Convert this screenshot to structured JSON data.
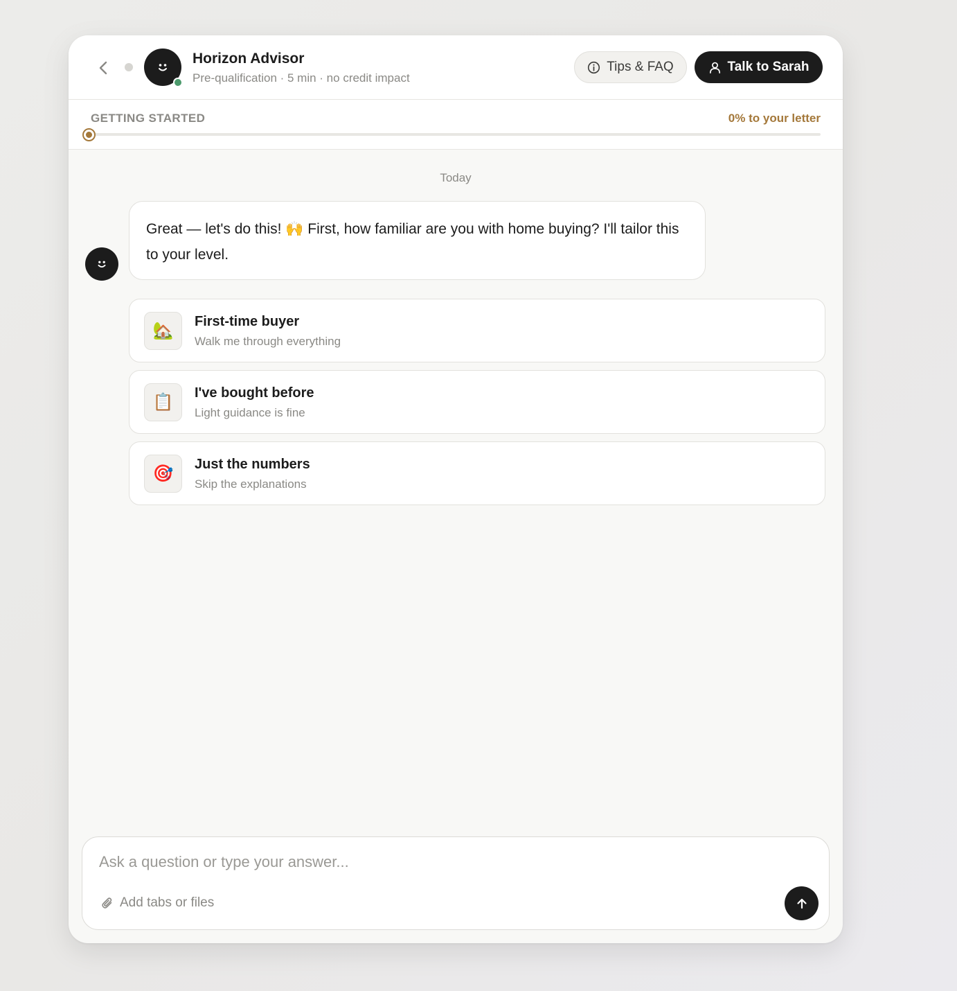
{
  "header": {
    "title": "Horizon Advisor",
    "subtitle": "Pre-qualification · 5 min · no credit impact",
    "tips_label": "Tips & FAQ",
    "talk_label": "Talk to Sarah"
  },
  "progress": {
    "stage": "GETTING STARTED",
    "percent_label": "0% to your letter",
    "percent": 0
  },
  "chat": {
    "date_label": "Today",
    "message": "Great — let's do this! 🙌 First, how familiar are you with home buying? I'll tailor this to your level.",
    "options": [
      {
        "icon": "🏡",
        "title": "First-time buyer",
        "subtitle": "Walk me through everything"
      },
      {
        "icon": "📋",
        "title": "I've bought before",
        "subtitle": "Light guidance is fine"
      },
      {
        "icon": "🎯",
        "title": "Just the numbers",
        "subtitle": "Skip the explanations"
      }
    ]
  },
  "composer": {
    "placeholder": "Ask a question or type your answer...",
    "value": "",
    "attach_label": "Add tabs or files"
  },
  "colors": {
    "accent": "#a4783a",
    "dark": "#1c1c1c",
    "online": "#4c9a6c"
  }
}
